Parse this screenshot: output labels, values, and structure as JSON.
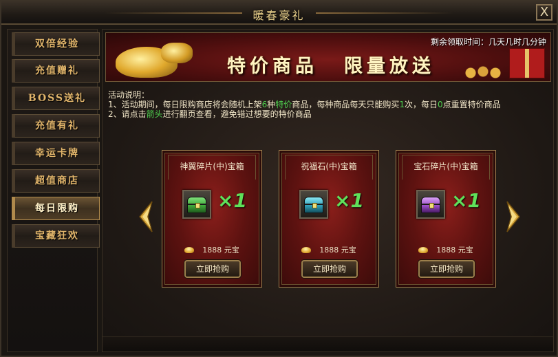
{
  "window": {
    "title": "暖春豪礼",
    "close_label": "X"
  },
  "sidebar": {
    "active_index": 6,
    "items": [
      {
        "label": "双倍经验"
      },
      {
        "label": "充值赠礼"
      },
      {
        "label": "BOSS送礼"
      },
      {
        "label": "充值有礼"
      },
      {
        "label": "幸运卡牌"
      },
      {
        "label": "超值商店"
      },
      {
        "label": "每日限购"
      },
      {
        "label": "宝藏狂欢"
      }
    ]
  },
  "banner": {
    "title_left": "特价商品",
    "title_right": "限量放送",
    "timer": "剩余领取时间：几天几时几分钟"
  },
  "description": {
    "heading": "活动说明：",
    "line1_a": "1、活动期间，每日限购商店将会随机上架",
    "line1_b": "6",
    "line1_c": "种",
    "line1_d": "特价",
    "line1_e": "商品，每种商品每天只能购买",
    "line1_f": "1",
    "line1_g": "次，每日",
    "line1_h": "0",
    "line1_i": "点重置特价商品",
    "line2_a": "2、请点击",
    "line2_b": "箭头",
    "line2_c": "进行翻页查看，避免错过想要的特价商品"
  },
  "products": [
    {
      "name": "神翼碎片(中)宝箱",
      "qty": "×1",
      "price": "1888",
      "currency": "元宝",
      "button": "立即抢购",
      "chest_color": "#3fa83a"
    },
    {
      "name": "祝福石(中)宝箱",
      "qty": "×1",
      "price": "1888",
      "currency": "元宝",
      "button": "立即抢购",
      "chest_color": "#2f9fb8"
    },
    {
      "name": "宝石碎片(中)宝箱",
      "qty": "×1",
      "price": "1888",
      "currency": "元宝",
      "button": "立即抢购",
      "chest_color": "#9a4fc8"
    }
  ],
  "icons": {
    "prev": "chevron-left-icon",
    "next": "chevron-right-icon",
    "ingot": "gold-ingot-icon"
  },
  "colors": {
    "accent_gold": "#e1b56b",
    "highlight_green": "#4fd04f",
    "card_red": "#8c1f1b"
  }
}
